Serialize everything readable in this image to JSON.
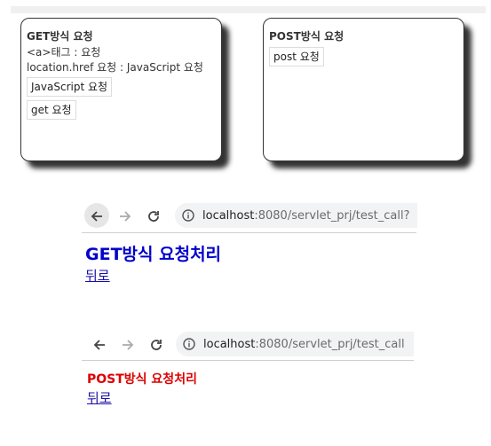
{
  "get_card": {
    "title": "GET방식 요청",
    "line_a_tag": "<a>태그 : 요청",
    "line_location": "location.href 요청 : JavaScript 요청",
    "js_button": "JavaScript 요청",
    "get_button": "get 요청"
  },
  "post_card": {
    "title": "POST방식 요청",
    "post_button": "post 요청"
  },
  "browser_get": {
    "url_host": "localhost",
    "url_path": ":8080/servlet_prj/test_call?",
    "result_title": "GET방식 요청처리",
    "back_link": "뒤로"
  },
  "browser_post": {
    "url_host": "localhost",
    "url_path": ":8080/servlet_prj/test_call",
    "result_title": "POST방식 요청처리",
    "back_link": "뒤로"
  },
  "colors": {
    "get_title": "#0000cc",
    "post_title": "#dd0000",
    "link": "#1a0dab"
  },
  "icons": [
    "back-arrow-icon",
    "forward-arrow-icon",
    "reload-icon",
    "info-icon"
  ]
}
